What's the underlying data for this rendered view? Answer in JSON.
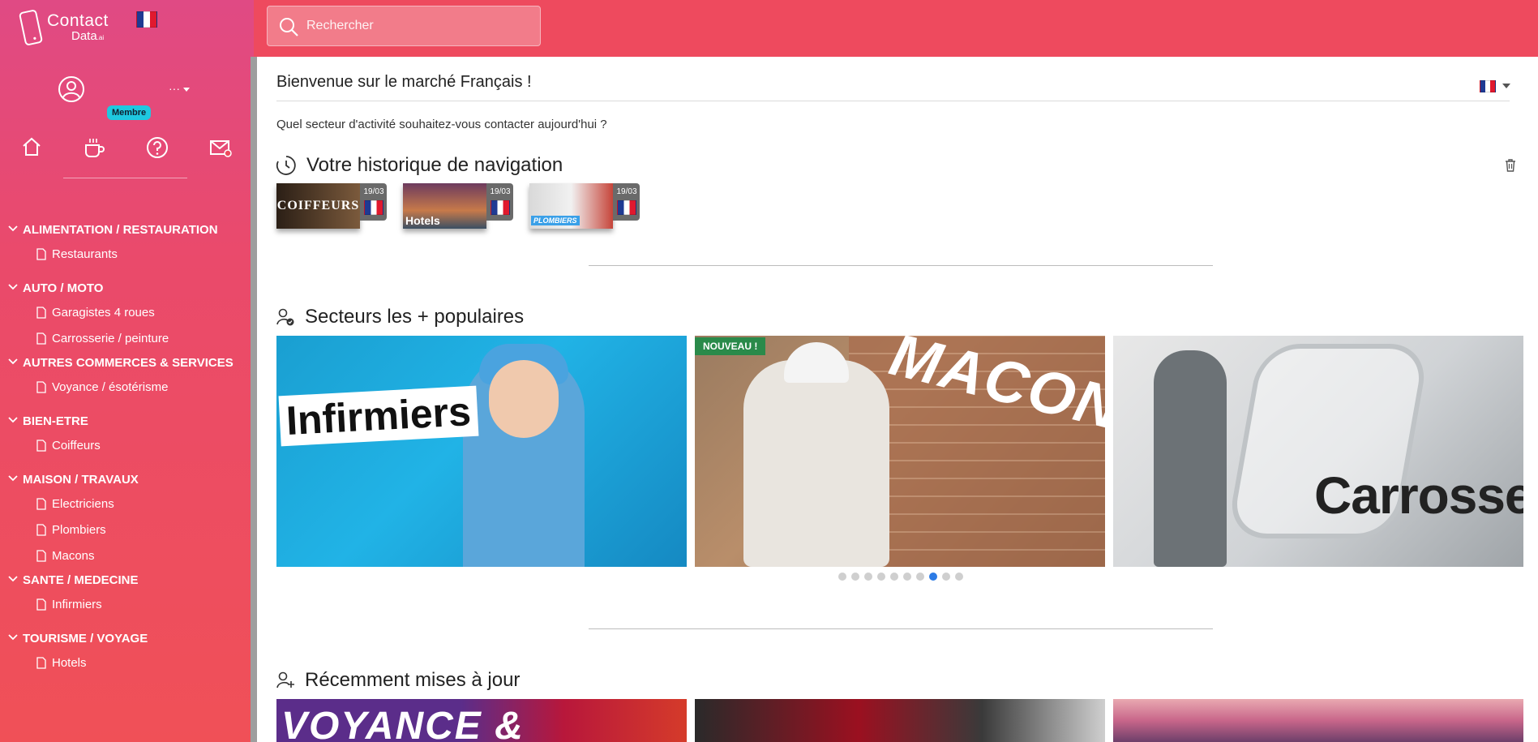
{
  "search": {
    "placeholder": "Rechercher"
  },
  "brand": {
    "line1": "Contact",
    "line2": "Data",
    "line2_suffix": ".ai"
  },
  "user": {
    "name": "···",
    "badge": "Membre"
  },
  "quick_icons": [
    "home-icon",
    "coffee-icon",
    "help-icon",
    "mail-icon"
  ],
  "nav": [
    {
      "label": "ALIMENTATION / RESTAURATION",
      "items": [
        "Restaurants"
      ]
    },
    {
      "label": "AUTO / MOTO",
      "items": [
        "Garagistes 4 roues",
        "Carrosserie / peinture"
      ]
    },
    {
      "label": "AUTRES COMMERCES & SERVICES",
      "items": [
        "Voyance / ésotérisme"
      ]
    },
    {
      "label": "BIEN-ETRE",
      "items": [
        "Coiffeurs"
      ]
    },
    {
      "label": "MAISON / TRAVAUX",
      "items": [
        "Electriciens",
        "Plombiers",
        "Macons"
      ]
    },
    {
      "label": "SANTE / MEDECINE",
      "items": [
        "Infirmiers"
      ]
    },
    {
      "label": "TOURISME / VOYAGE",
      "items": [
        "Hotels"
      ]
    }
  ],
  "main": {
    "title": "Bienvenue sur le marché Français !",
    "question": "Quel secteur d'activité souhaitez-vous contacter aujourd'hui ?"
  },
  "history": {
    "title": "Votre historique de navigation",
    "items": [
      {
        "label": "COIFFEURS",
        "date": "19/03"
      },
      {
        "label": "Hotels",
        "date": "19/03"
      },
      {
        "label": "PLOMBIERS",
        "date": "19/03"
      }
    ]
  },
  "popular": {
    "title": "Secteurs les + populaires",
    "tiles": [
      {
        "label": "Infirmiers",
        "badge": ""
      },
      {
        "label": "MACONS",
        "badge": "NOUVEAU !"
      },
      {
        "label": "Carrosserie",
        "badge": ""
      }
    ],
    "dots_count": 10,
    "active_dot": 8
  },
  "recent": {
    "title": "Récemment mises à jour",
    "tiles": [
      {
        "label": "VOYANCE &"
      },
      {
        "label": ""
      },
      {
        "label": ""
      }
    ]
  },
  "colors": {
    "topbar": "#ee4a5e",
    "sidebar_top": "#e04a84",
    "sidebar_bottom": "#f05057",
    "badge": "#1ec8e0",
    "new_badge": "#2a8a4a",
    "active_dot": "#2c7be5"
  }
}
